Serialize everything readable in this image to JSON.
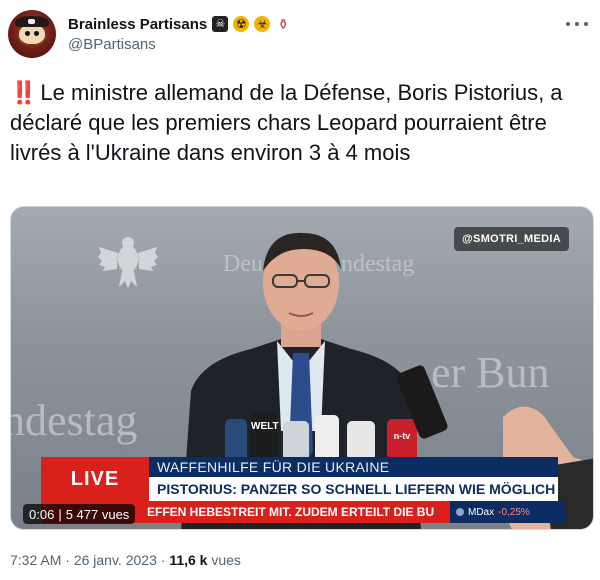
{
  "author": {
    "display_name": "Brainless Partisans",
    "handle": "@BPartisans",
    "emoji_icons": [
      "pirate-flag-icon",
      "radioactive-icon",
      "biohazard-icon",
      "potion-icon"
    ]
  },
  "tweet": {
    "alert_icon": "‼️",
    "text": "Le ministre allemand de la Défense, Boris Pistorius, a déclaré que les premiers chars Leopard pourraient être livrés à l'Ukraine dans environ 3 à 4 mois"
  },
  "video": {
    "watermark": "@SMOTRI_MEDIA",
    "wall_text_1": "Deu",
    "wall_text_1b": "ndestag",
    "wall_text_2": "er Bun",
    "wall_text_3": "ndestag",
    "live_label": "LIVE",
    "ticker_line1": "WAFFENHILFE FÜR DIE UKRAINE",
    "ticker_line2": "PISTORIUS: PANZER SO SCHNELL LIEFERN WIE MÖGLICH",
    "ticker_line3": "EFFEN HEBESTREIT MIT. ZUDEM ERTEILT DIE BU",
    "mdax_label": "MDax",
    "mdax_value": "-0,25%",
    "elapsed": "0:06",
    "views_in_player": "5 477 vues",
    "mic_labels": [
      "WELT",
      "n-tv"
    ]
  },
  "meta": {
    "time": "7:32 AM",
    "separator": "·",
    "date": "26 janv. 2023",
    "view_count": "11,6 k",
    "view_label": "vues"
  },
  "colors": {
    "accent_red": "#d9201b",
    "ticker_navy": "#0b2d63",
    "text_primary": "#0f1419",
    "text_secondary": "#536471"
  }
}
